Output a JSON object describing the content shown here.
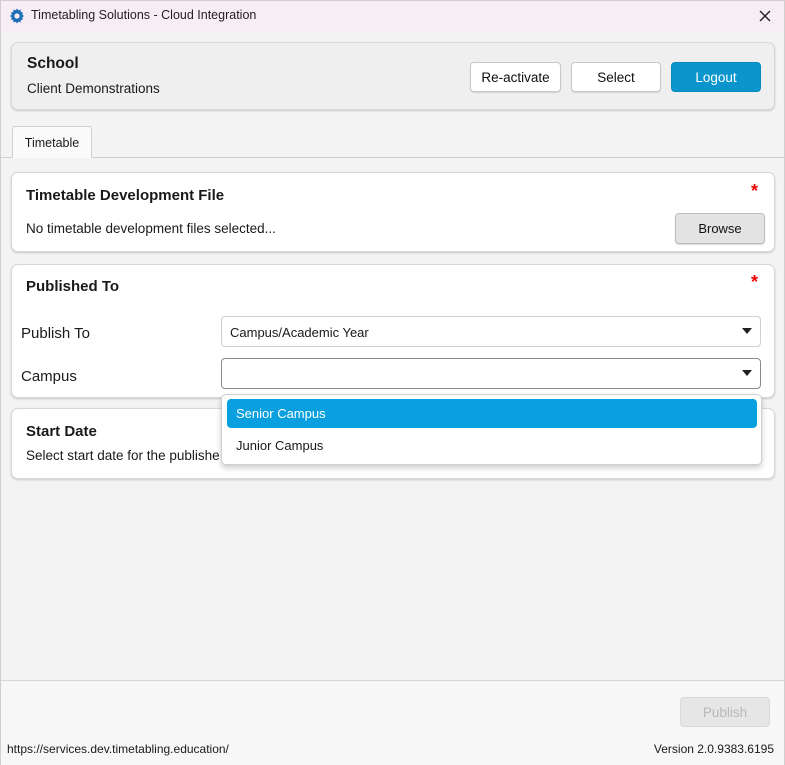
{
  "window": {
    "title": "Timetabling Solutions - Cloud Integration",
    "icon": "gear-icon",
    "close_icon": "close-icon"
  },
  "school": {
    "heading": "School",
    "name": "Client Demonstrations",
    "reactivate_label": "Re-activate",
    "select_label": "Select",
    "logout_label": "Logout",
    "accent_color": "#0a96cd"
  },
  "tabs": [
    {
      "label": "Timetable",
      "active": true
    }
  ],
  "dev_file": {
    "title": "Timetable Development File",
    "required_marker": "*",
    "status": "No timetable development files selected...",
    "browse_label": "Browse"
  },
  "published_to": {
    "title": "Published To",
    "required_marker": "*",
    "publish_to_label": "Publish To",
    "publish_to_value": "Campus/Academic Year",
    "campus_label": "Campus",
    "campus_value": ""
  },
  "campus_dropdown": {
    "options": [
      "Senior Campus",
      "Junior Campus"
    ],
    "highlighted": "Senior Campus"
  },
  "start_date": {
    "title": "Start Date",
    "description": "Select start date for the publishe"
  },
  "footer": {
    "publish_label": "Publish",
    "url": "https://services.dev.timetabling.education/",
    "version": "Version 2.0.9383.6195"
  }
}
